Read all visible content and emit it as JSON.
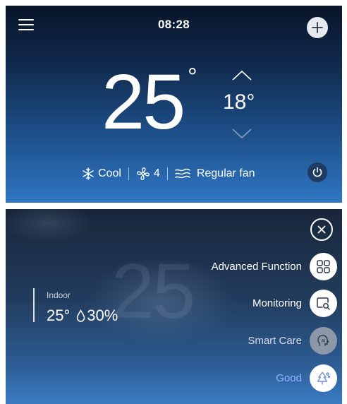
{
  "top_screen": {
    "clock": "08:28",
    "current_temp": "25",
    "current_temp_unit": "°",
    "set_temp": "18°",
    "mode_label": "Cool",
    "fan_speed": "4",
    "fan_mode_label": "Regular fan",
    "icons": {
      "menu": "hamburger-menu-icon",
      "add": "plus-icon",
      "up": "chevron-up-icon",
      "down": "chevron-down-icon",
      "mode": "snowflake-icon",
      "fan": "fan-icon",
      "wind": "wind-icon",
      "power": "power-icon"
    }
  },
  "bottom_screen": {
    "background_temp": "25",
    "indoor_label": "Indoor",
    "indoor_temp": "25°",
    "indoor_humidity": "30%",
    "menu": [
      {
        "label": "Advanced Function",
        "icon": "grid-icon"
      },
      {
        "label": "Monitoring",
        "icon": "monitor-search-icon"
      },
      {
        "label": "Smart Care",
        "icon": "ai-care-icon"
      },
      {
        "label": "Good",
        "icon": "air-quality-icon"
      }
    ],
    "close_icon": "close-icon"
  },
  "colors": {
    "good_accent": "#8fb4ff",
    "smart_care_circle": "#8c98a8",
    "power_button": "#1e3b63"
  }
}
